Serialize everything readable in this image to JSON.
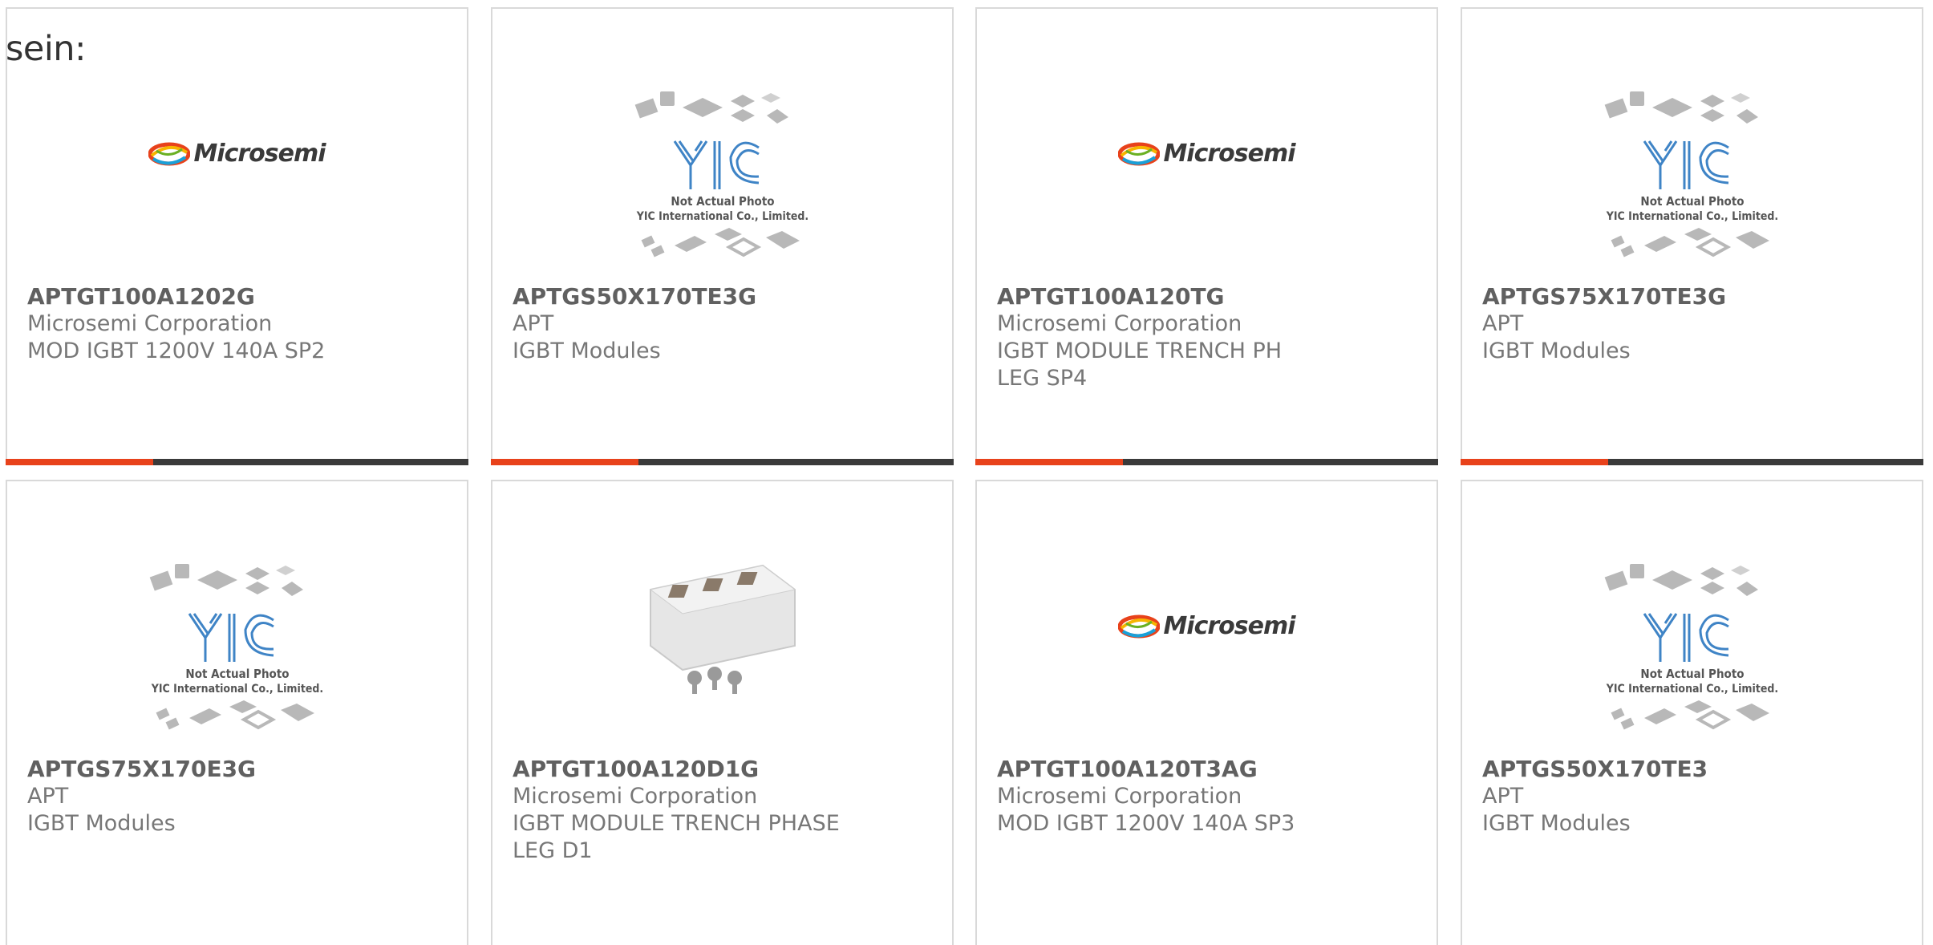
{
  "lead_text": "sein:",
  "logos": {
    "microsemi": "Microsemi",
    "yic_caption1": "Not Actual Photo",
    "yic_caption2": "YIC International Co., Limited."
  },
  "colors": {
    "accent": "#e8421b",
    "bar": "#3a3a3a",
    "border": "#d9d9d9"
  },
  "products": [
    {
      "part": "APTGT100A1202G",
      "manufacturer": "Microsemi Corporation",
      "description": "MOD IGBT 1200V 140A SP2",
      "image": "microsemi-logo"
    },
    {
      "part": "APTGS50X170TE3G",
      "manufacturer": "APT",
      "description": "IGBT Modules",
      "image": "yic-placeholder"
    },
    {
      "part": "APTGT100A120TG",
      "manufacturer": "Microsemi Corporation",
      "description": "IGBT MODULE TRENCH PH LEG SP4",
      "image": "microsemi-logo"
    },
    {
      "part": "APTGS75X170TE3G",
      "manufacturer": "APT",
      "description": "IGBT Modules",
      "image": "yic-placeholder"
    },
    {
      "part": "APTGS75X170E3G",
      "manufacturer": "APT",
      "description": "IGBT Modules",
      "image": "yic-placeholder"
    },
    {
      "part": "APTGT100A120D1G",
      "manufacturer": "Microsemi Corporation",
      "description": "IGBT MODULE TRENCH PHASE LEG D1",
      "image": "igbt-module-photo"
    },
    {
      "part": "APTGT100A120T3AG",
      "manufacturer": "Microsemi Corporation",
      "description": "MOD IGBT 1200V 140A SP3",
      "image": "microsemi-logo"
    },
    {
      "part": "APTGS50X170TE3",
      "manufacturer": "APT",
      "description": "IGBT Modules",
      "image": "yic-placeholder"
    }
  ]
}
